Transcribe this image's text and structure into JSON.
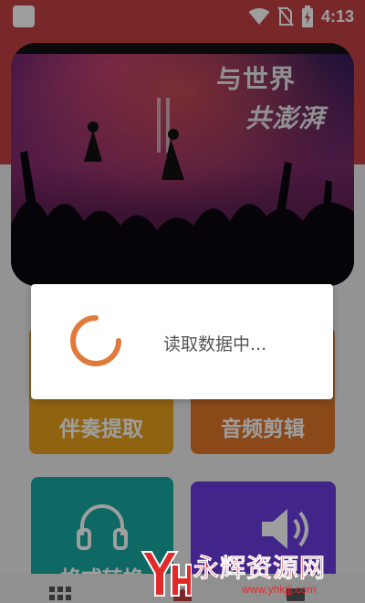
{
  "status_bar": {
    "time": "4:13"
  },
  "banner": {
    "line1": "与世界",
    "line2": "共澎湃"
  },
  "cards": [
    {
      "label": "伴奏提取",
      "color": "#e8a11c"
    },
    {
      "label": "音频剪辑",
      "color": "#e0762a"
    },
    {
      "label": "格式转换",
      "color": "#17a8a0"
    },
    {
      "label": "",
      "color": "#6a3ce0"
    }
  ],
  "dialog": {
    "message": "读取数据中..."
  },
  "colors": {
    "header": "#c44244",
    "spinner": "#e07a3a"
  },
  "watermark": {
    "title": "永辉资源网",
    "url": "www.yhkjjj.com"
  }
}
